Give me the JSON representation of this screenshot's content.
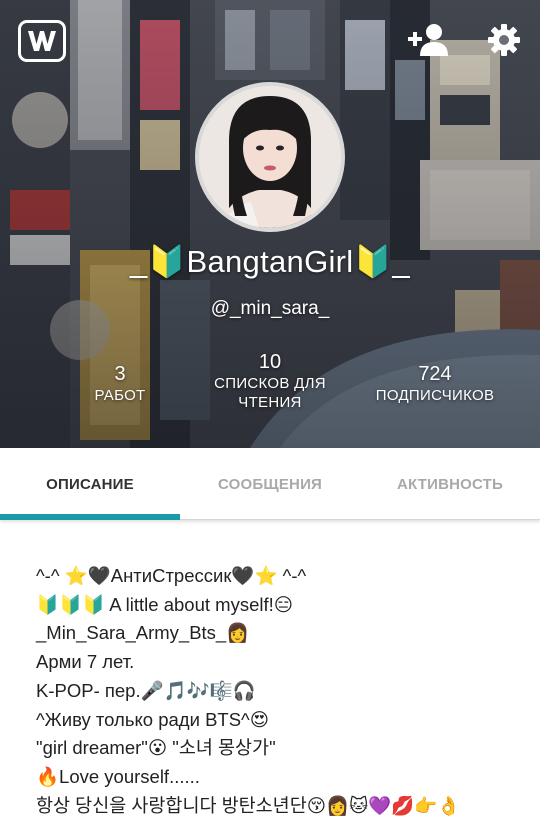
{
  "profile": {
    "username": "_🔰BangtanGirl🔰_",
    "handle": "@_min_sara_"
  },
  "stats": {
    "works": {
      "value": "3",
      "label": "РАБОТ"
    },
    "reading_lists": {
      "value": "10",
      "label_line1": "СПИСКОВ ДЛЯ",
      "label_line2": "ЧТЕНИЯ"
    },
    "followers": {
      "value": "724",
      "label": "ПОДПИСЧИКОВ"
    }
  },
  "tabs": [
    {
      "label": "ОПИСАНИЕ",
      "active": true
    },
    {
      "label": "СООБЩЕНИЯ",
      "active": false
    },
    {
      "label": "АКТИВНОСТЬ",
      "active": false
    }
  ],
  "description": {
    "lines": [
      "^-^ ⭐🖤АнтиСтрессик🖤⭐ ^-^",
      "🔰🔰🔰 A little about myself!😑",
      "_Min_Sara_Army_Bts_👩",
      "Арми 7 лет.",
      "K-POP- пер.🎤🎵🎶🎼🎧",
      "^Живу только ради BTS^😍",
      "\"girl dreamer\"😮 \"소녀 몽상가\"",
      "🔥Love yourself......",
      "항상 당신을 사랑합니다 방탄소년단😚👩🐱💜💋👉👌"
    ]
  },
  "icons": {
    "app_logo": "wattpad-w-icon",
    "follow": "add-user-icon",
    "settings": "gear-icon"
  },
  "colors": {
    "accent": "#1b9aa8",
    "tab_active_text": "#333333",
    "tab_inactive_text": "#a9a9a9"
  }
}
